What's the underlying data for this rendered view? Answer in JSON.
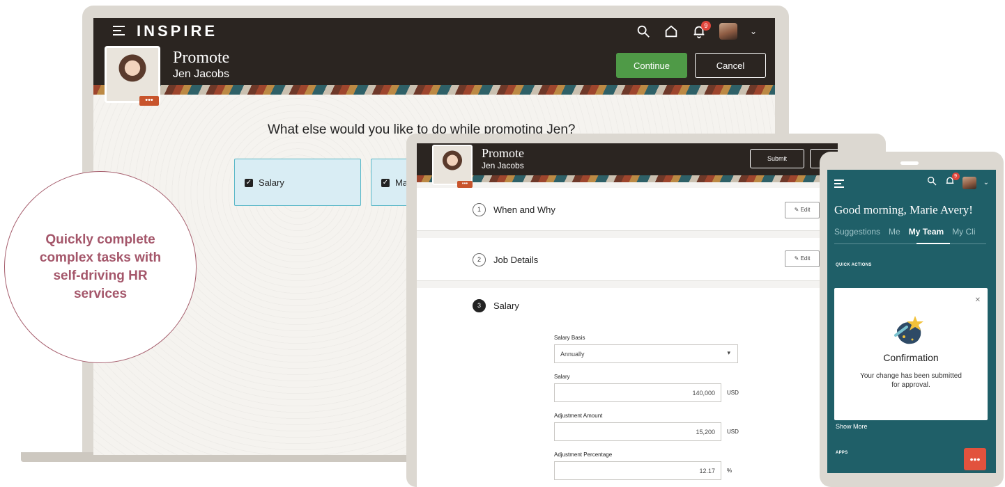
{
  "laptop": {
    "brand": "INSPIRE",
    "notification_count": "9",
    "page_title": "Promote",
    "person_name": "Jen Jacobs",
    "avatar_more": "•••",
    "continue_label": "Continue",
    "cancel_label": "Cancel",
    "question": "What else would you like to do while promoting Jen?",
    "options": [
      {
        "label": "Salary",
        "checked": true
      },
      {
        "label": "Manager",
        "checked": true
      }
    ]
  },
  "callout": {
    "text": "Quickly complete complex tasks with self-driving HR services",
    "color": "#a4566a"
  },
  "tablet": {
    "page_title": "Promote",
    "person_name": "Jen Jacobs",
    "avatar_more": "•••",
    "submit_label": "Submit",
    "edit_label": "Edit",
    "steps": [
      {
        "num": "1",
        "label": "When and Why"
      },
      {
        "num": "2",
        "label": "Job Details"
      },
      {
        "num": "3",
        "label": "Salary"
      }
    ],
    "fields": {
      "salary_basis_label": "Salary Basis",
      "salary_basis_value": "Annually",
      "salary_label": "Salary",
      "salary_value": "140,000",
      "salary_unit": "USD",
      "adjustment_amount_label": "Adjustment Amount",
      "adjustment_amount_value": "15,200",
      "adjustment_amount_unit": "USD",
      "adjustment_percentage_label": "Adjustment Percentage",
      "adjustment_percentage_value": "12.17",
      "adjustment_percentage_unit": "%"
    }
  },
  "phone": {
    "notification_count": "9",
    "greeting": "Good morning, Marie Avery!",
    "tabs": [
      "Suggestions",
      "Me",
      "My Team",
      "My Cli"
    ],
    "active_tab": "My Team",
    "quick_actions": "QUICK ACTIONS",
    "modal_title": "Confirmation",
    "modal_message": "Your change has been submitted for approval.",
    "show_more": "Show More",
    "apps": "APPS"
  },
  "colors": {
    "header_dark": "#2b2521",
    "continue_green": "#4f9a47",
    "option_bg": "#d9edf4",
    "option_border": "#59b7c7",
    "phone_teal": "#1f5f68",
    "badge_red": "#e0463c",
    "chat_orange": "#e2523d"
  },
  "icons": [
    "menu-icon",
    "search-icon",
    "home-icon",
    "bell-icon",
    "chevron-down-icon",
    "checkbox-icon",
    "pencil-icon",
    "close-icon",
    "chat-icon",
    "shooting-star-icon"
  ]
}
